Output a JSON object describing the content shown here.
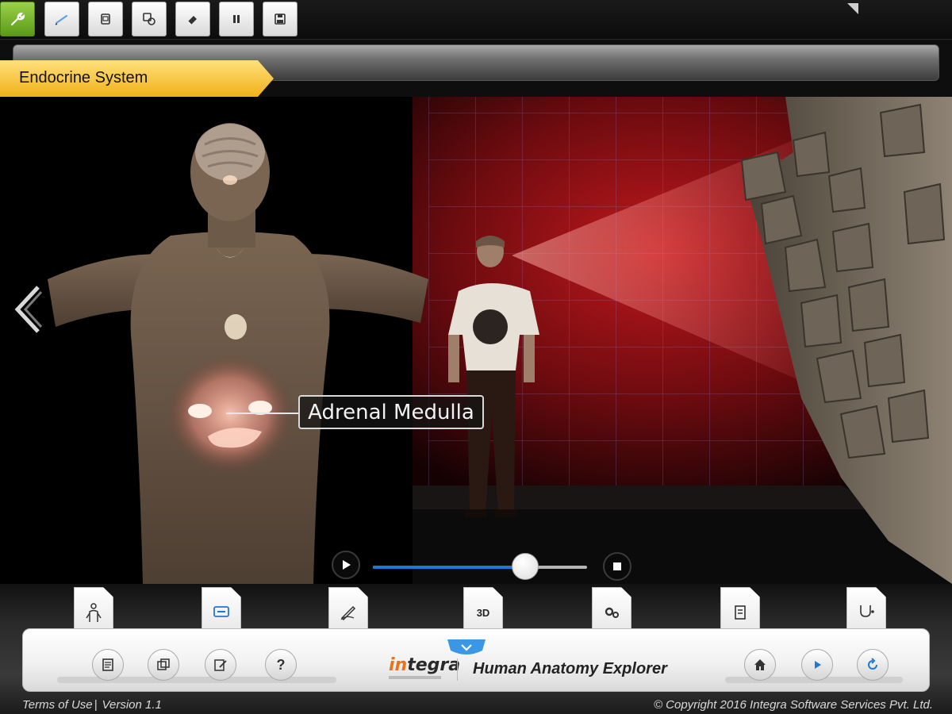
{
  "app": {
    "name": "Human Anatomy Explorer",
    "logo_in": "in",
    "logo_tegra": "tegra"
  },
  "toolbar": {
    "tools": [
      "wrench-icon",
      "pen-icon",
      "copy-icon",
      "layers-icon",
      "eraser-icon",
      "pause-icon",
      "save-icon"
    ],
    "active_tool": "wrench-icon",
    "accent_color": "#6fb026"
  },
  "header": {
    "section_title": "Endocrine System",
    "tag_color": "#f5c331"
  },
  "scene": {
    "callout_label": "Adrenal Medulla"
  },
  "player": {
    "progress": 0.71,
    "accent_color": "#1e78d6"
  },
  "bottom_tabs": [
    {
      "icon": "body-outline-icon"
    },
    {
      "icon": "quiz-icon"
    },
    {
      "icon": "draw-icon"
    },
    {
      "label": "3D"
    },
    {
      "icon": "gears-icon"
    },
    {
      "icon": "notes-icon"
    },
    {
      "icon": "stethoscope-icon"
    }
  ],
  "dock": {
    "left_buttons": [
      "document-icon",
      "gallery-icon",
      "edit-icon",
      "help-icon"
    ],
    "help_label": "?",
    "right_buttons": [
      "home-icon",
      "play-icon",
      "refresh-icon"
    ]
  },
  "footer": {
    "terms": "Terms of Use",
    "separator": "|",
    "version": "Version 1.1",
    "copyright": "© Copyright 2016 Integra Software Services Pvt. Ltd."
  }
}
